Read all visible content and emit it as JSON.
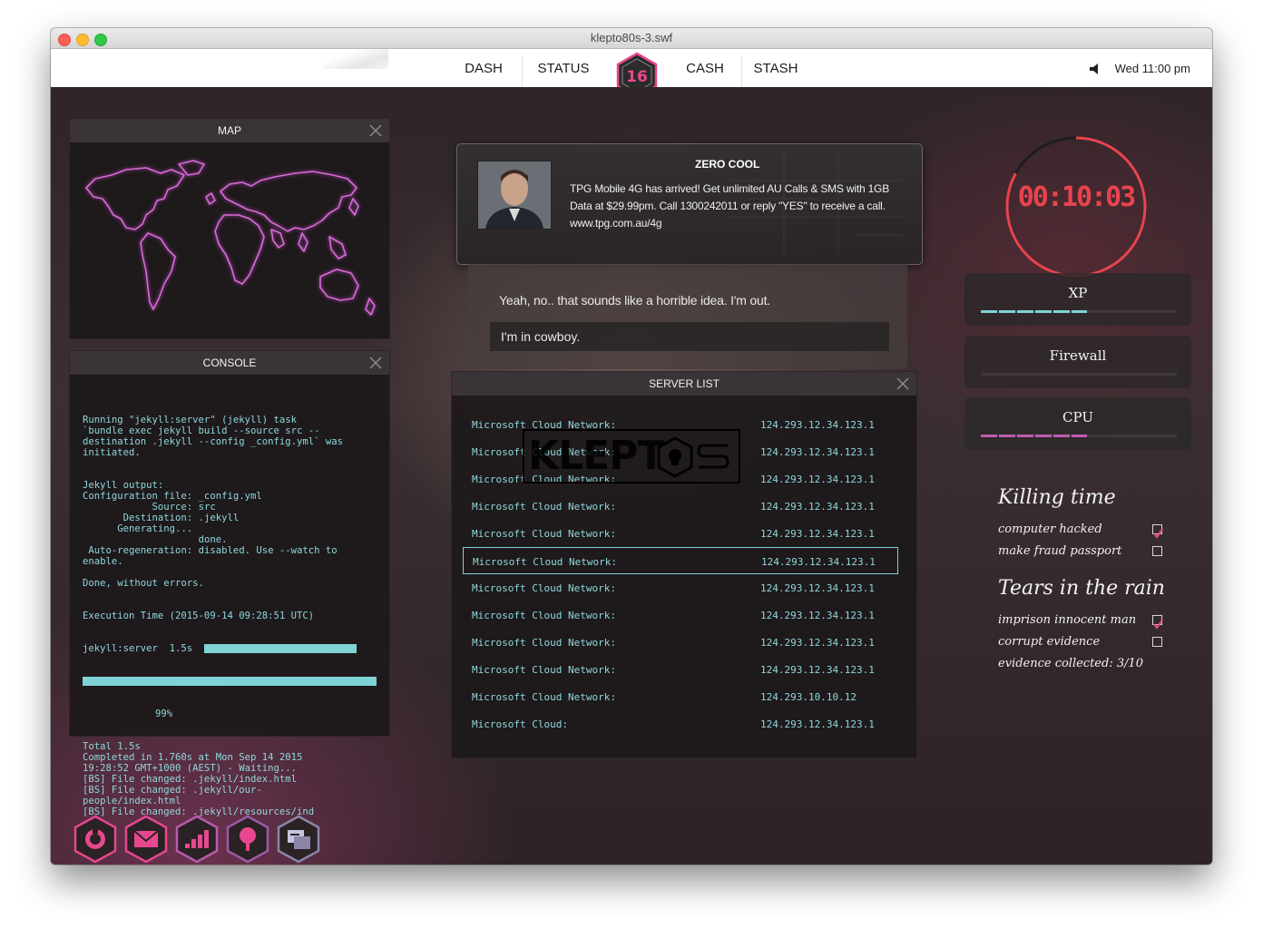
{
  "window": {
    "title": "klepto80s-3.swf"
  },
  "nav": {
    "items": [
      "DASH",
      "STATUS",
      "CASH",
      "STASH"
    ],
    "level": "16",
    "clock": "Wed 11:00 pm",
    "speaker_icon": "speaker-icon"
  },
  "map": {
    "title": "MAP"
  },
  "console": {
    "title": "CONSOLE",
    "lines": [
      "Running \"jekyll:server\" (jekyll) task",
      "`bundle exec jekyll build --source src --",
      "destination .jekyll --config _config.yml` was",
      "initiated.",
      "",
      "",
      "Jekyll output:",
      "Configuration file: _config.yml",
      "            Source: src",
      "       Destination: .jekyll",
      "      Generating...",
      "                    done.",
      " Auto-regeneration: disabled. Use --watch to",
      "enable.",
      "",
      "Done, without errors.",
      "",
      "",
      "Execution Time (2015-09-14 09:28:51 UTC)"
    ],
    "task_line": "jekyll:server  1.5s",
    "task_pct": "99%",
    "tail": [
      "Total 1.5s",
      "Completed in 1.760s at Mon Sep 14 2015",
      "19:28:52 GMT+1000 (AEST) - Waiting...",
      "[BS] File changed: .jekyll/index.html",
      "[BS] File changed: .jekyll/our-",
      "people/index.html",
      "[BS] File changed: .jekyll/resources/ind"
    ]
  },
  "notification": {
    "sender": "ZERO COOL",
    "message": "TPG Mobile 4G has arrived! Get unlimited AU Calls & SMS with 1GB Data at $29.99pm. Call 1300242011 or reply \"YES\" to receive a call. www.tpg.com.au/4g"
  },
  "dialog": {
    "line": "Yeah, no.. that sounds like a horrible idea. I'm out.",
    "option": "I'm in cowboy."
  },
  "server_list": {
    "title": "SERVER LIST",
    "logo_text": "KLEPT",
    "rows": [
      {
        "name": "Microsoft Cloud Network:",
        "ip": "124.293.12.34.123.1"
      },
      {
        "name": "Microsoft Cloud Network:",
        "ip": "124.293.12.34.123.1"
      },
      {
        "name": "Microsoft Cloud Network:",
        "ip": "124.293.12.34.123.1"
      },
      {
        "name": "Microsoft Cloud Network:",
        "ip": "124.293.12.34.123.1"
      },
      {
        "name": "Microsoft Cloud Network:",
        "ip": "124.293.12.34.123.1"
      },
      {
        "name": "Microsoft Cloud Network:",
        "ip": "124.293.12.34.123.1"
      },
      {
        "name": "Microsoft Cloud Network:",
        "ip": "124.293.12.34.123.1"
      },
      {
        "name": "Microsoft Cloud Network:",
        "ip": "124.293.12.34.123.1"
      },
      {
        "name": "Microsoft Cloud Network:",
        "ip": "124.293.12.34.123.1"
      },
      {
        "name": "Microsoft Cloud Network:",
        "ip": "124.293.12.34.123.1"
      },
      {
        "name": "Microsoft Cloud Network:",
        "ip": "124.293.10.10.12"
      },
      {
        "name": "Microsoft Cloud:",
        "ip": "124.293.12.34.123.1"
      }
    ],
    "selected_index": 5
  },
  "timer": {
    "value": "00:10:03",
    "remaining_fraction": 0.83,
    "color": "#e8444e"
  },
  "stats": [
    {
      "label": "XP",
      "fill": 0.54,
      "color": "#7fd3d4"
    },
    {
      "label": "Firewall",
      "fill": 0.0,
      "color": "#7fd3d4"
    },
    {
      "label": "CPU",
      "fill": 0.54,
      "color": "#c05bb0"
    }
  ],
  "quests": [
    {
      "title": "Killing time",
      "items": [
        {
          "label": "computer hacked",
          "checked": true
        },
        {
          "label": "make fraud passport",
          "checked": false
        }
      ]
    },
    {
      "title": "Tears in the rain",
      "items": [
        {
          "label": "imprison innocent man",
          "checked": true
        },
        {
          "label": "corrupt evidence",
          "checked": false
        }
      ],
      "note": "evidence collected: 3/10"
    }
  ],
  "dock": [
    {
      "icon": "power-icon"
    },
    {
      "icon": "mail-icon"
    },
    {
      "icon": "signal-bars-icon"
    },
    {
      "icon": "pin-icon"
    },
    {
      "icon": "chat-icon"
    }
  ],
  "colors": {
    "accent": "#e8488f",
    "cyan": "#7fd3d4",
    "timer_red": "#e8444e"
  }
}
